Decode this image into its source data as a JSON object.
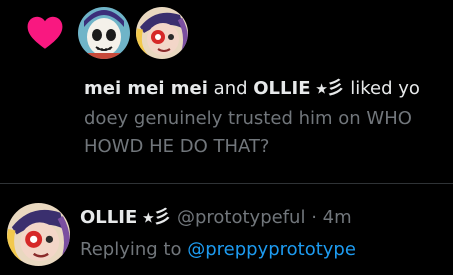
{
  "notification": {
    "icon": "heart-icon",
    "icon_color": "#f91880",
    "actor1": "mei mei mei",
    "connector": " and ",
    "actor2": "OLLIE",
    "actor2_decor": "⭑彡",
    "action": " liked yo",
    "post_line1": "doey genuinely trusted him on WHO",
    "post_line2": "HOWD HE DO THAT?"
  },
  "reply": {
    "name": "OLLIE",
    "name_decor": "⭑彡",
    "handle": "@prototypeful",
    "separator": " · ",
    "time": "4m",
    "replying_prefix": "Replying to ",
    "replying_to": "@preppyprototype"
  },
  "colors": {
    "background": "#000000",
    "primary_text": "#e7e9ea",
    "secondary_text": "#71767b",
    "link": "#1d9bf0",
    "divider": "#2f3336"
  }
}
